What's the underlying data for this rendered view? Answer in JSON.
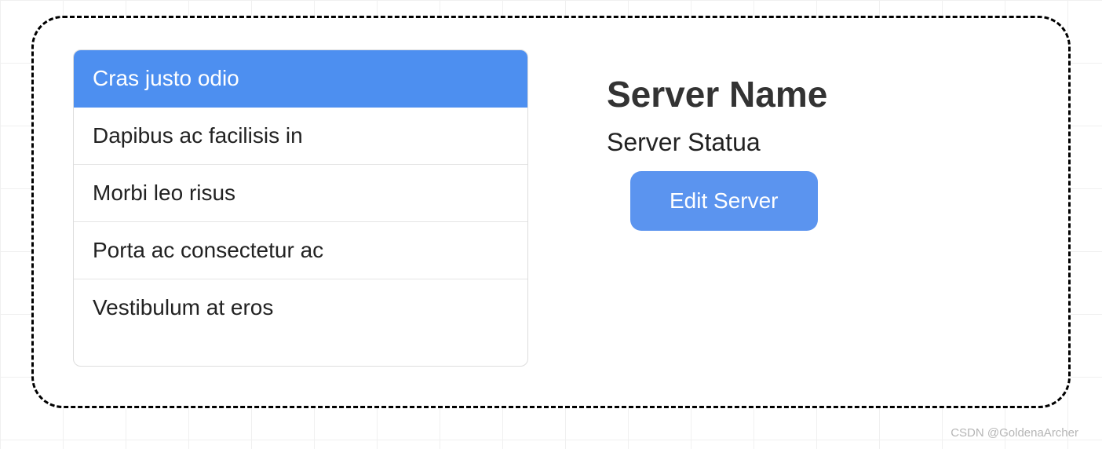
{
  "list": {
    "items": [
      {
        "label": "Cras justo odio",
        "active": true
      },
      {
        "label": "Dapibus ac facilisis in",
        "active": false
      },
      {
        "label": "Morbi leo risus",
        "active": false
      },
      {
        "label": "Porta ac consectetur ac",
        "active": false
      },
      {
        "label": "Vestibulum at eros",
        "active": false
      }
    ]
  },
  "detail": {
    "title": "Server Name",
    "status": "Server Statua",
    "edit_label": "Edit Server"
  },
  "watermark": "CSDN @GoldenaArcher",
  "colors": {
    "accent": "#5b94ef",
    "active_bg": "#4d8ff0"
  }
}
